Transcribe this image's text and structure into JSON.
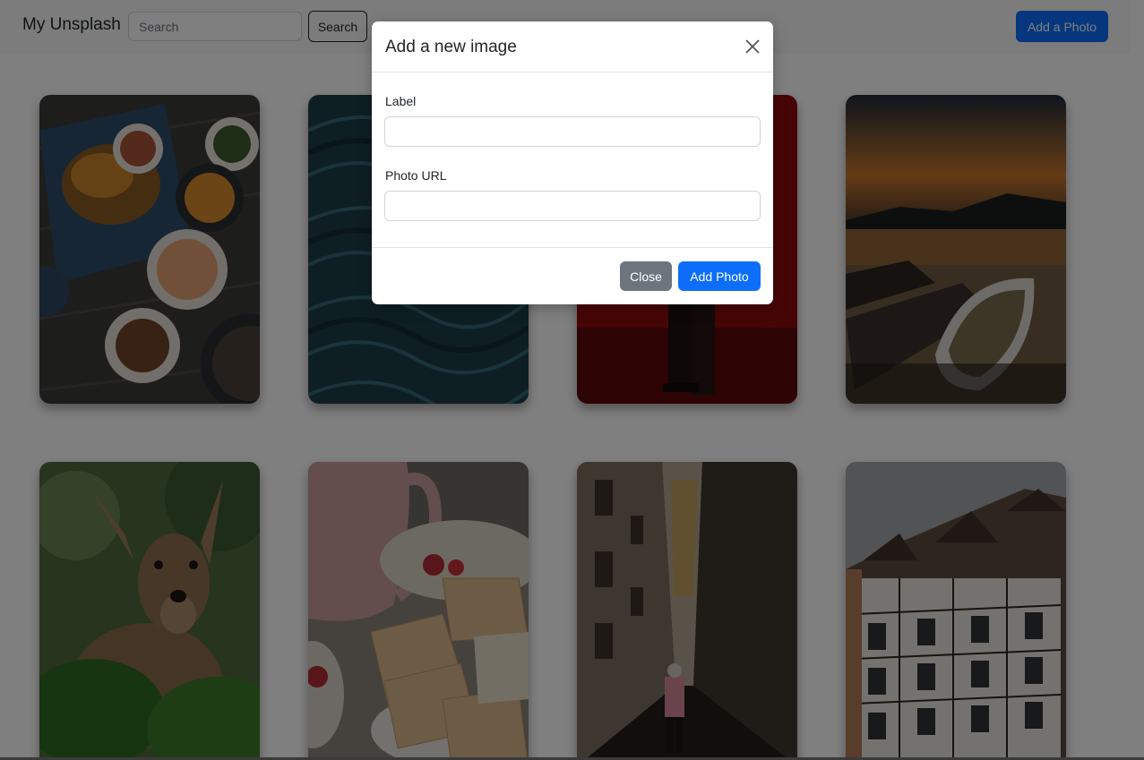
{
  "navbar": {
    "brand": "My Unsplash",
    "search_placeholder": "Search",
    "search_button": "Search",
    "add_photo_button": "Add a Photo"
  },
  "gallery": {
    "photos": [
      {
        "subject": "food-platter"
      },
      {
        "subject": "water-waves"
      },
      {
        "subject": "red-sky-silhouette"
      },
      {
        "subject": "lake-boat-sunset"
      },
      {
        "subject": "deer"
      },
      {
        "subject": "crackers-mug"
      },
      {
        "subject": "narrow-alley"
      },
      {
        "subject": "half-timbered-houses"
      }
    ]
  },
  "modal": {
    "title": "Add a new image",
    "label_field": {
      "label": "Label",
      "value": "",
      "placeholder": ""
    },
    "url_field": {
      "label": "Photo URL",
      "value": "",
      "placeholder": ""
    },
    "close_button": "Close",
    "add_button": "Add Photo"
  },
  "colors": {
    "primary": "#0d6efd",
    "secondary": "#6c757d",
    "navbar_bg": "#f8f9fa",
    "backdrop": "rgba(0,0,0,0.5)"
  }
}
